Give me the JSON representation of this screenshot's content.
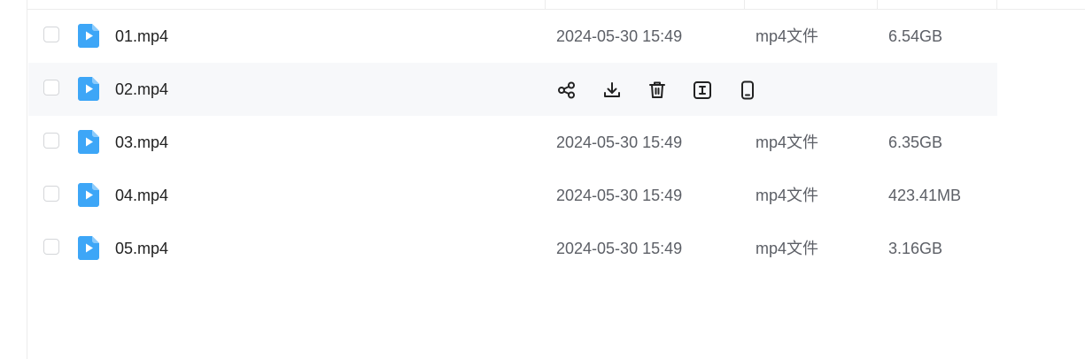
{
  "colors": {
    "file_icon": "#3da6f7",
    "row_hover": "#f7f8fa",
    "text_primary": "#222222",
    "text_secondary": "#5c5f66"
  },
  "files": [
    {
      "name": "01.mp4",
      "modified": "2024-05-30 15:49",
      "type": "mp4文件",
      "size": "6.54GB",
      "hovered": false
    },
    {
      "name": "02.mp4",
      "modified": "",
      "type": "",
      "size": "",
      "hovered": true
    },
    {
      "name": "03.mp4",
      "modified": "2024-05-30 15:49",
      "type": "mp4文件",
      "size": "6.35GB",
      "hovered": false
    },
    {
      "name": "04.mp4",
      "modified": "2024-05-30 15:49",
      "type": "mp4文件",
      "size": "423.41MB",
      "hovered": false
    },
    {
      "name": "05.mp4",
      "modified": "2024-05-30 15:49",
      "type": "mp4文件",
      "size": "3.16GB",
      "hovered": false
    }
  ],
  "row_actions": [
    "share-icon",
    "download-icon",
    "delete-icon",
    "rename-icon",
    "mobile-icon"
  ]
}
